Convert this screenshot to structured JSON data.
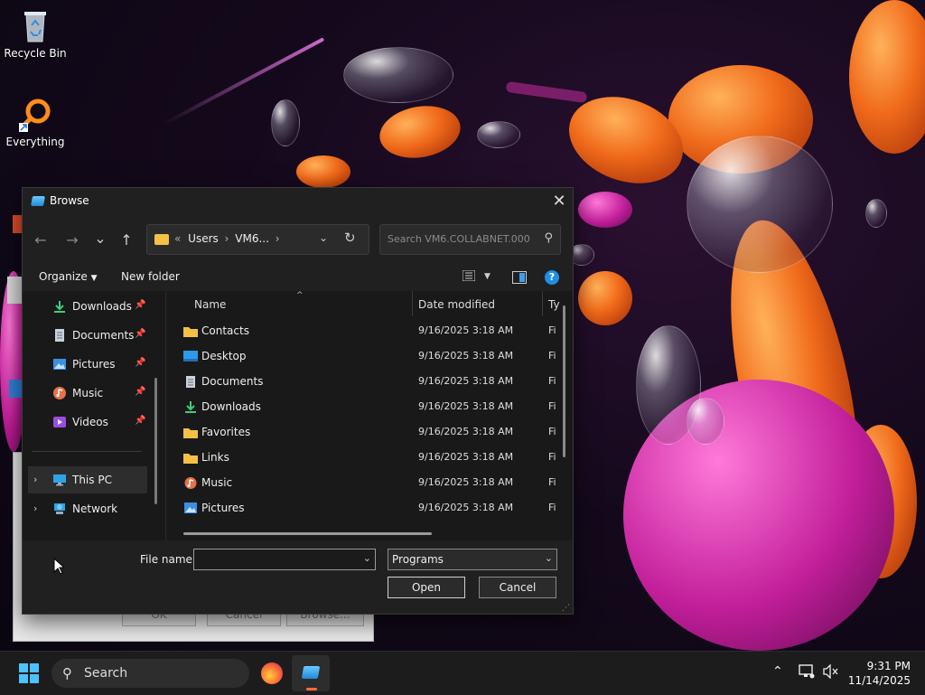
{
  "desktop": {
    "icons": [
      {
        "label": "Recycle Bin"
      },
      {
        "label": "Everything"
      }
    ]
  },
  "background_dialog": {
    "ok_label": "OK",
    "cancel_label": "Cancel",
    "browse_label": "Browse..."
  },
  "dialog": {
    "title": "Browse",
    "close_glyph": "✕",
    "nav": {
      "back": "←",
      "forward": "→",
      "recent": "⌄",
      "up": "↑"
    },
    "address": {
      "overflow": "«",
      "crumbs": [
        "Users",
        "VM6..."
      ],
      "separator": "›"
    },
    "search_placeholder": "Search VM6.COLLABNET.000",
    "toolbar": {
      "organize_label": "Organize",
      "new_folder_label": "New folder",
      "help": "?"
    },
    "nav_pane": {
      "quick_access": [
        {
          "label": "Downloads",
          "icon": "downloads-icon"
        },
        {
          "label": "Documents",
          "icon": "documents-icon"
        },
        {
          "label": "Pictures",
          "icon": "pictures-icon"
        },
        {
          "label": "Music",
          "icon": "music-icon"
        },
        {
          "label": "Videos",
          "icon": "videos-icon"
        }
      ],
      "tree": [
        {
          "label": "This PC",
          "icon": "this-pc-icon"
        },
        {
          "label": "Network",
          "icon": "network-icon"
        }
      ]
    },
    "columns": {
      "name": "Name",
      "date_modified": "Date modified",
      "type": "Ty"
    },
    "files": [
      {
        "name": "Contacts",
        "date": "9/16/2025 3:18 AM",
        "type": "Fi",
        "icon": "folder-icon"
      },
      {
        "name": "Desktop",
        "date": "9/16/2025 3:18 AM",
        "type": "Fi",
        "icon": "desktop-folder-icon"
      },
      {
        "name": "Documents",
        "date": "9/16/2025 3:18 AM",
        "type": "Fi",
        "icon": "documents-icon"
      },
      {
        "name": "Downloads",
        "date": "9/16/2025 3:18 AM",
        "type": "Fi",
        "icon": "downloads-icon"
      },
      {
        "name": "Favorites",
        "date": "9/16/2025 3:18 AM",
        "type": "Fi",
        "icon": "folder-icon"
      },
      {
        "name": "Links",
        "date": "9/16/2025 3:18 AM",
        "type": "Fi",
        "icon": "folder-icon"
      },
      {
        "name": "Music",
        "date": "9/16/2025 3:18 AM",
        "type": "Fi",
        "icon": "music-icon"
      },
      {
        "name": "Pictures",
        "date": "9/16/2025 3:18 AM",
        "type": "Fi",
        "icon": "pictures-icon"
      }
    ],
    "file_name_label": "File name:",
    "file_name_value": "",
    "file_type_value": "Programs",
    "open_label": "Open",
    "cancel_label": "Cancel"
  },
  "taskbar": {
    "search_label": "Search",
    "time": "9:31 PM",
    "date": "11/14/2025"
  },
  "colors": {
    "accent": "#4cc2ff",
    "help_blue": "#1f8fe6",
    "folder_yellow": "#f3c145",
    "dialog_bg": "#191919"
  }
}
